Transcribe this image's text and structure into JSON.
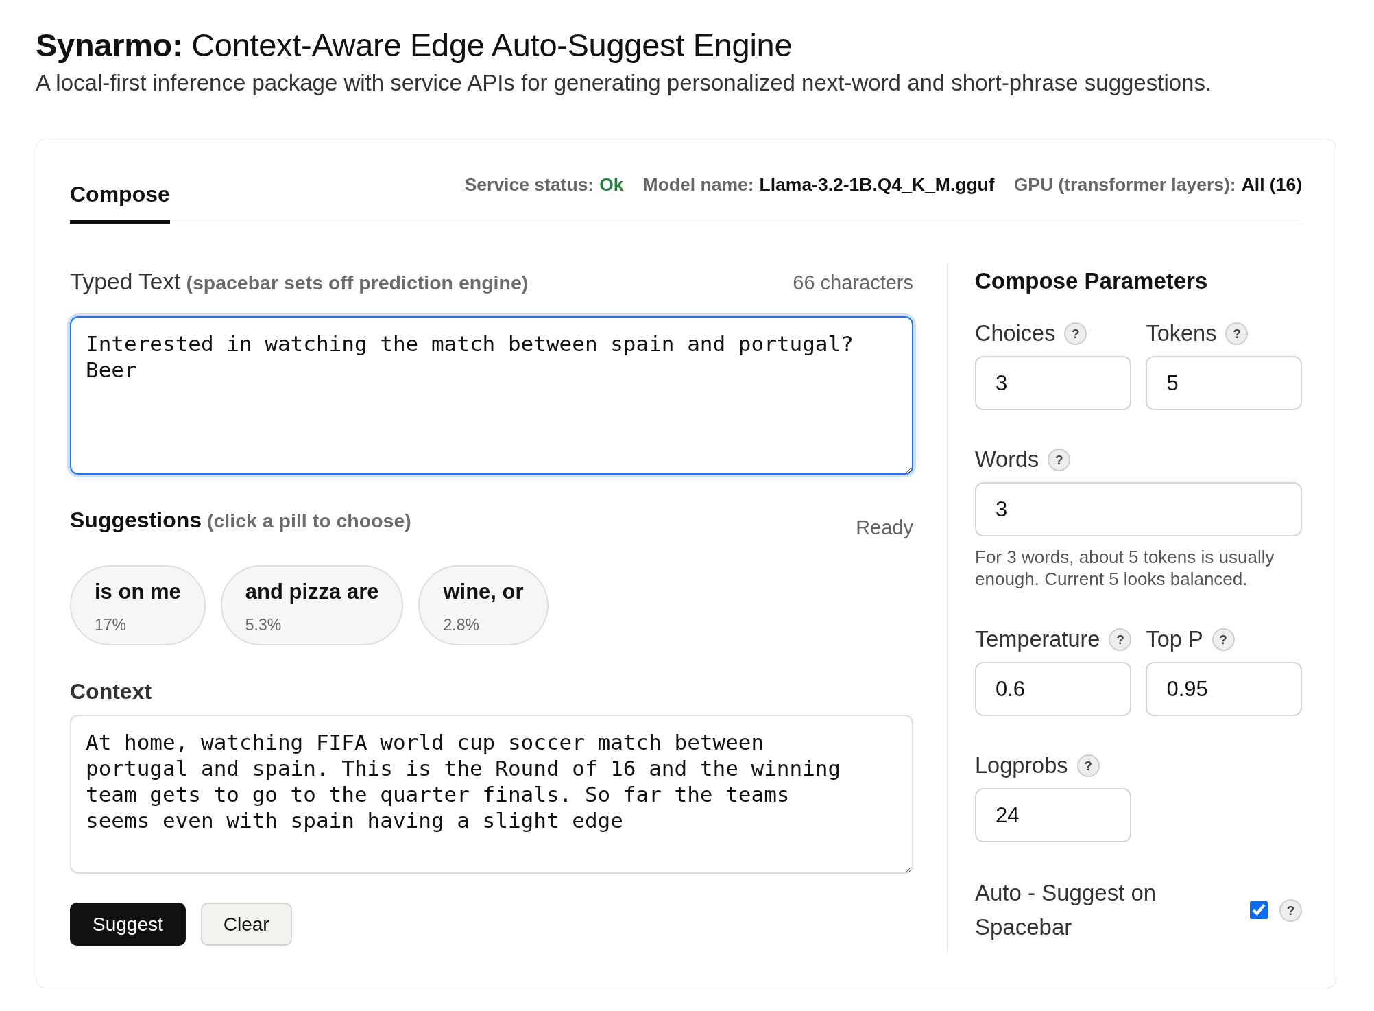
{
  "header": {
    "title": "**Synarmo:** Context-Aware Edge Auto-Suggest Engine",
    "subtitle": "A local-first inference package with service APIs for generating personalized next-word and short-phrase suggestions."
  },
  "tabs": [
    {
      "label": "Compose",
      "selected": true
    }
  ],
  "status_items": [
    {
      "label": "Service status:",
      "value": "Ok",
      "color": "#23803a"
    },
    {
      "label": "Model name:",
      "value": "Llama-3.2-1B.Q4_K_M.gguf",
      "color": "#111111"
    },
    {
      "label": "GPU (transformer layers):",
      "value": "All (16)",
      "color": "#111111"
    }
  ],
  "typed_text": {
    "label": "Typed Text",
    "hint": "(spacebar sets off prediction engine)",
    "count": "66 characters",
    "value": "Interested in watching the match between spain and portugal? Beer",
    "focused": true
  },
  "suggestions": {
    "title": "Suggestions",
    "hint": "(click a pill to choose)",
    "status": "Ready",
    "items": [
      {
        "text": "is on me",
        "probability": "17%",
        "selected": false
      },
      {
        "text": "and pizza are",
        "probability": "5.3%",
        "selected": false
      },
      {
        "text": "wine, or",
        "probability": "2.8%",
        "selected": false
      }
    ]
  },
  "context": {
    "label": "Context",
    "value": "At home, watching FIFA world cup soccer match between\nportugal and spain. This is the Round of 16 and the winning\nteam gets to go to the quarter finals. So far the teams\nseems even with spain having a slight edge"
  },
  "buttons": [
    {
      "label": "Suggest",
      "kind": "primary"
    },
    {
      "label": "Clear",
      "kind": "secondary"
    }
  ],
  "parameters": {
    "title": "Compose Parameters",
    "fields": [
      {
        "label": "Choices",
        "help": "?",
        "value": "3"
      },
      {
        "label": "Tokens",
        "help": "?",
        "value": "5"
      },
      {
        "label": "Words",
        "help": "?",
        "value": "3",
        "hint": "For 3 words, about 5 tokens is usually enough. Current 5 looks balanced."
      },
      {
        "label": "Temperature",
        "help": "?",
        "value": "0.6"
      },
      {
        "label": "Top P",
        "help": "?",
        "value": "0.95"
      },
      {
        "label": "Logprobs",
        "help": "?",
        "value": "24"
      }
    ],
    "auto_suggest": {
      "label": "Auto - Suggest on Spacebar",
      "checked": true,
      "help": "?"
    }
  }
}
